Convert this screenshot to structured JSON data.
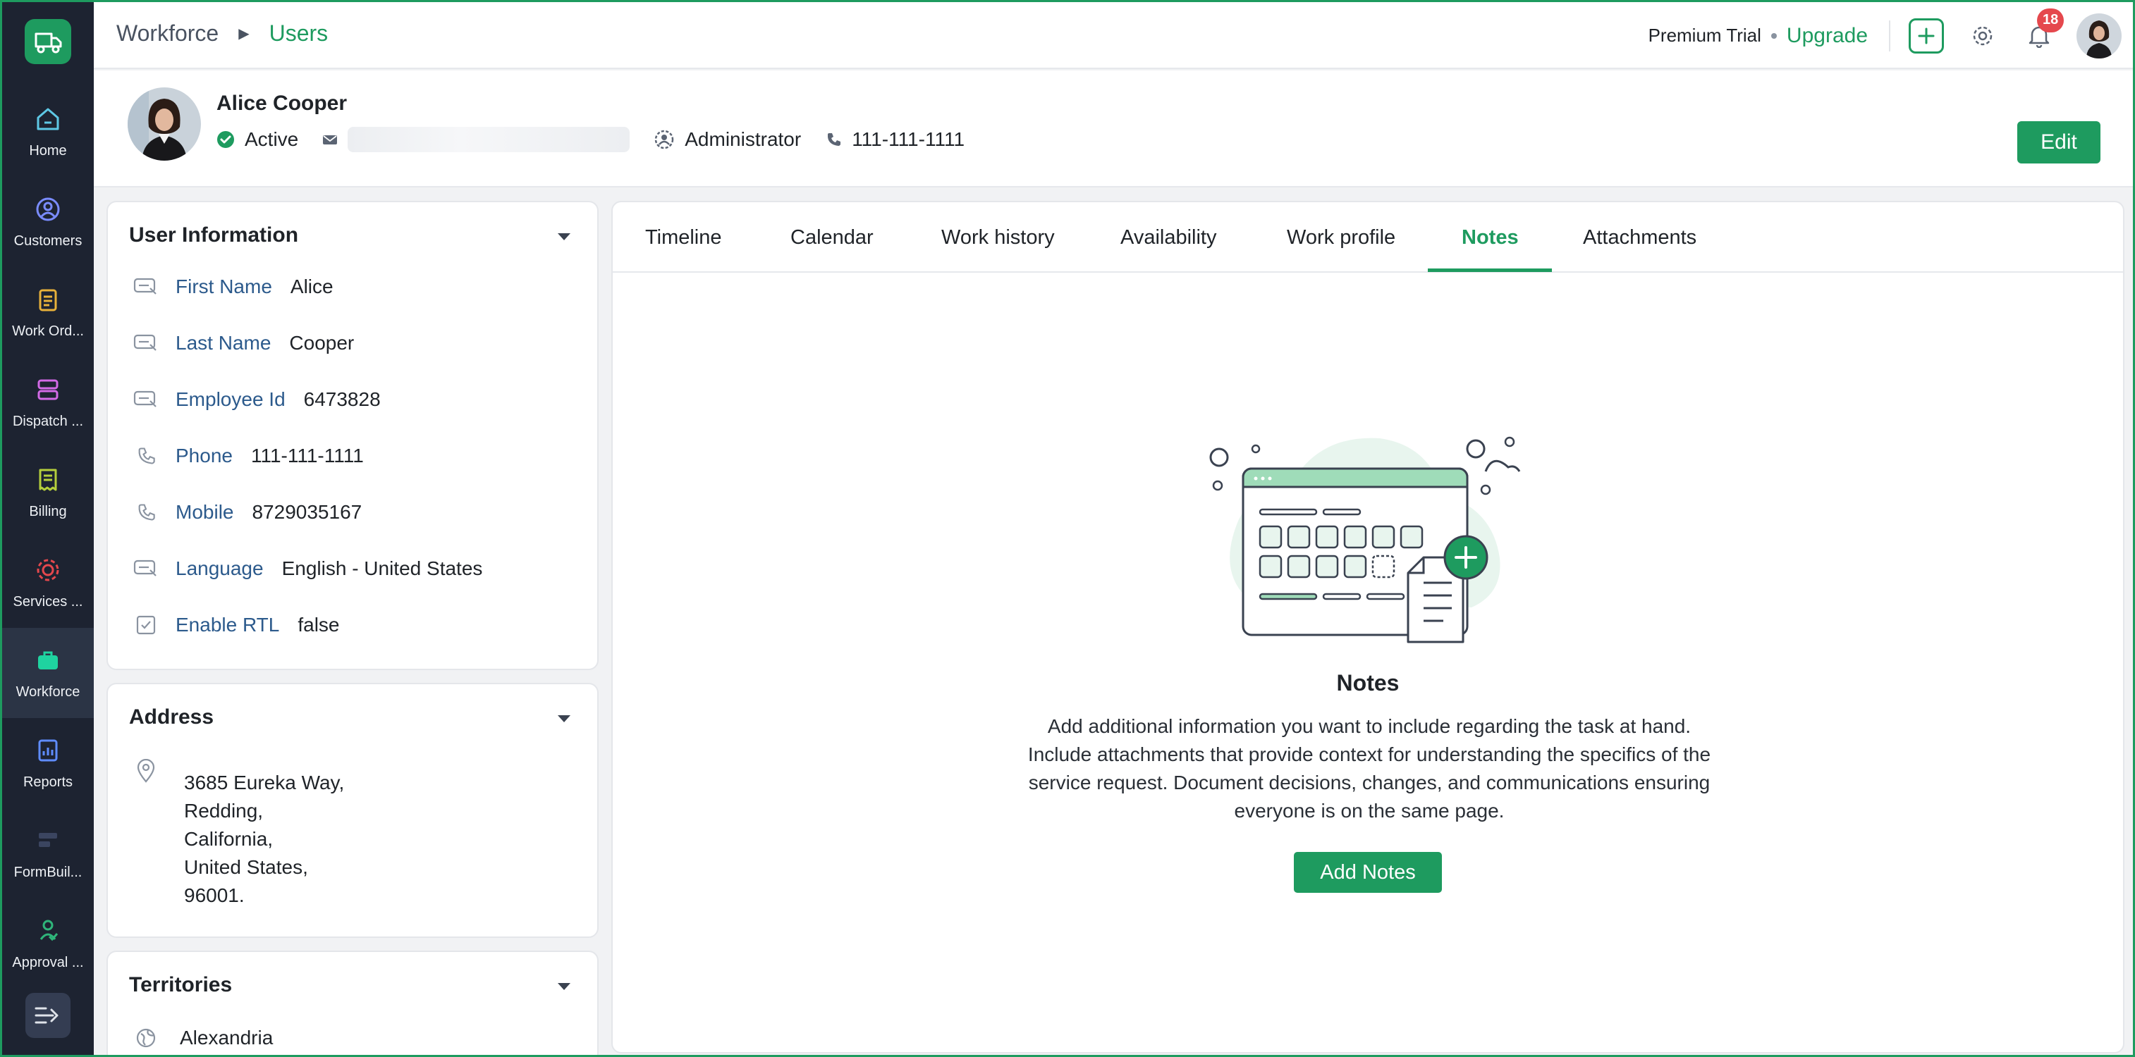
{
  "colors": {
    "accent": "#1e9b5f",
    "rail": "#1d2331",
    "label": "#2c5a8c",
    "badge": "#e5484d"
  },
  "rail": {
    "items": [
      {
        "label": "Home",
        "icon": "home-icon"
      },
      {
        "label": "Customers",
        "icon": "customers-icon"
      },
      {
        "label": "Work Ord...",
        "icon": "work-orders-icon"
      },
      {
        "label": "Dispatch ...",
        "icon": "dispatch-icon"
      },
      {
        "label": "Billing",
        "icon": "billing-icon"
      },
      {
        "label": "Services ...",
        "icon": "services-icon"
      },
      {
        "label": "Workforce",
        "icon": "workforce-icon",
        "active": true
      },
      {
        "label": "Reports",
        "icon": "reports-icon"
      },
      {
        "label": "FormBuil...",
        "icon": "formbuilder-icon"
      },
      {
        "label": "Approval ...",
        "icon": "approval-icon"
      }
    ]
  },
  "topbar": {
    "breadcrumb": {
      "parent": "Workforce",
      "current": "Users"
    },
    "trial_text": "Premium Trial",
    "upgrade_label": "Upgrade",
    "notification_count": "18"
  },
  "user": {
    "name": "Alice Cooper",
    "status": "Active",
    "role": "Administrator",
    "phone": "111-111-1111",
    "edit_label": "Edit"
  },
  "user_info": {
    "title": "User Information",
    "fields": [
      {
        "label": "First Name",
        "value": "Alice"
      },
      {
        "label": "Last Name",
        "value": "Cooper"
      },
      {
        "label": "Employee Id",
        "value": "6473828"
      },
      {
        "label": "Phone",
        "value": "111-111-1111"
      },
      {
        "label": "Mobile",
        "value": "8729035167"
      },
      {
        "label": "Language",
        "value": "English - United States"
      },
      {
        "label": "Enable RTL",
        "value": "false"
      }
    ]
  },
  "address": {
    "title": "Address",
    "lines": [
      "3685 Eureka Way,",
      "Redding,",
      "California,",
      "United States,",
      "96001."
    ]
  },
  "territories": {
    "title": "Territories",
    "items": [
      "Alexandria"
    ]
  },
  "tabs": [
    {
      "label": "Timeline"
    },
    {
      "label": "Calendar"
    },
    {
      "label": "Work history"
    },
    {
      "label": "Availability"
    },
    {
      "label": "Work profile"
    },
    {
      "label": "Notes",
      "active": true
    },
    {
      "label": "Attachments"
    }
  ],
  "notes_empty": {
    "title": "Notes",
    "description": "Add additional information you want to include regarding the task at hand. Include attachments that provide context for understanding the specifics of the service request. Document decisions, changes, and communications ensuring everyone is on the same page.",
    "button_label": "Add Notes"
  }
}
